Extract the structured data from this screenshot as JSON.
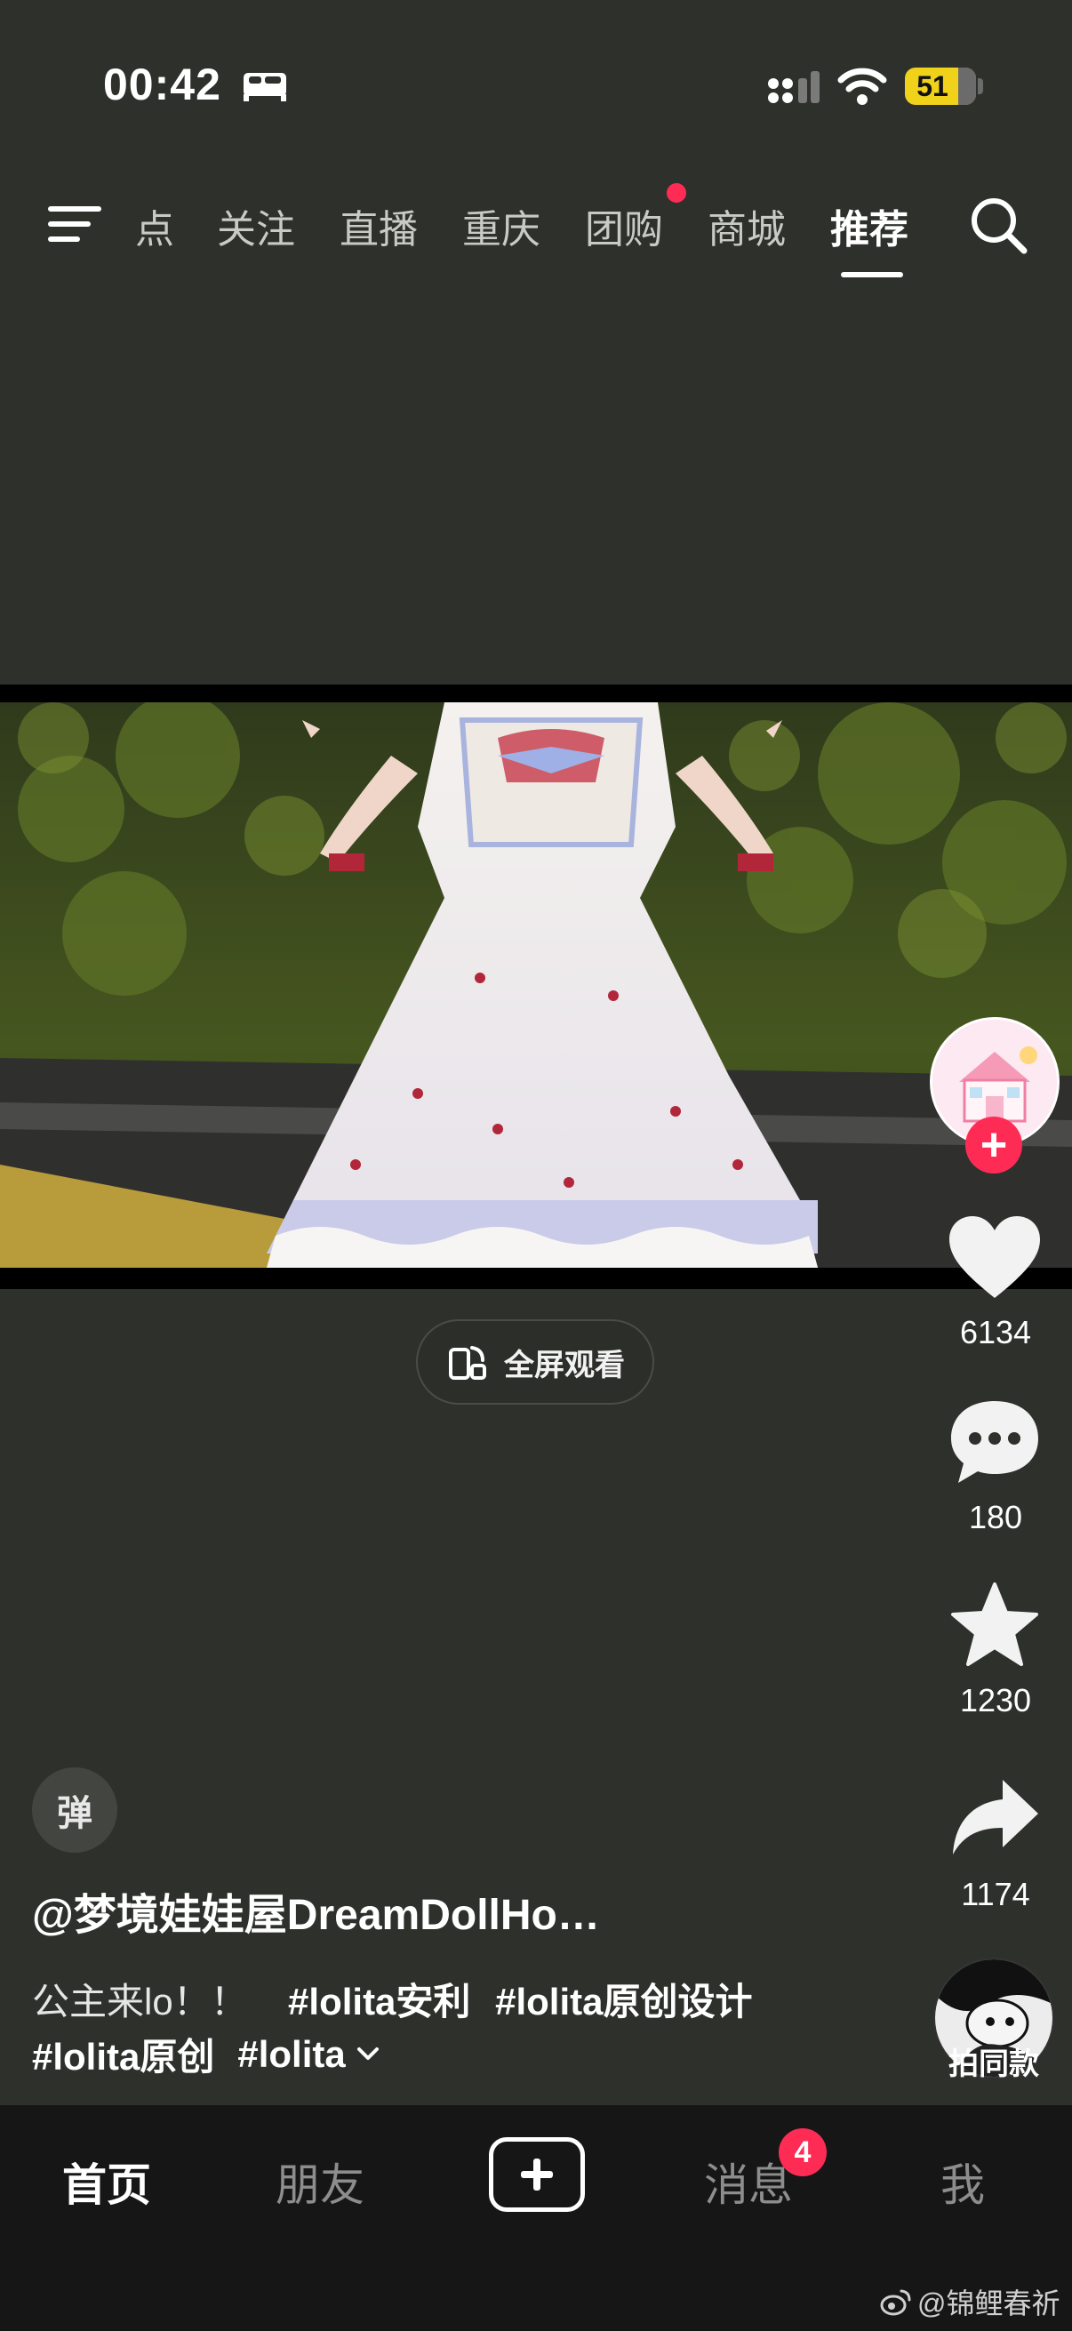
{
  "status_bar": {
    "time": "00:42",
    "battery": "51"
  },
  "top_nav": {
    "tabs": [
      {
        "label": "点"
      },
      {
        "label": "关注"
      },
      {
        "label": "直播"
      },
      {
        "label": "重庆"
      },
      {
        "label": "团购"
      },
      {
        "label": "商城"
      },
      {
        "label": "推荐"
      }
    ],
    "active_tab": "推荐"
  },
  "video": {
    "fullscreen_label": "全屏观看"
  },
  "right_rail": {
    "likes": "6134",
    "comments": "180",
    "favorites": "1230",
    "shares": "1174",
    "same_style_label": "拍同款",
    "follow_symbol": "+"
  },
  "post": {
    "danmaku_label": "弹",
    "author": "@梦境娃娃屋DreamDollHo…",
    "caption_text": "公主来lo！！",
    "hashtags_line1": [
      "#lolita安利",
      "#lolita原创设计"
    ],
    "hashtags_line2": [
      "#lolita原创",
      "#lolita"
    ]
  },
  "tab_bar": {
    "home": "首页",
    "friends": "朋友",
    "messages": "消息",
    "messages_badge": "4",
    "me": "我"
  },
  "watermark": "@锦鲤春祈",
  "colors": {
    "background": "#2e302b",
    "accent_red": "#fe2c55",
    "battery_yellow": "#f1d21a",
    "tabbar": "#161616"
  }
}
